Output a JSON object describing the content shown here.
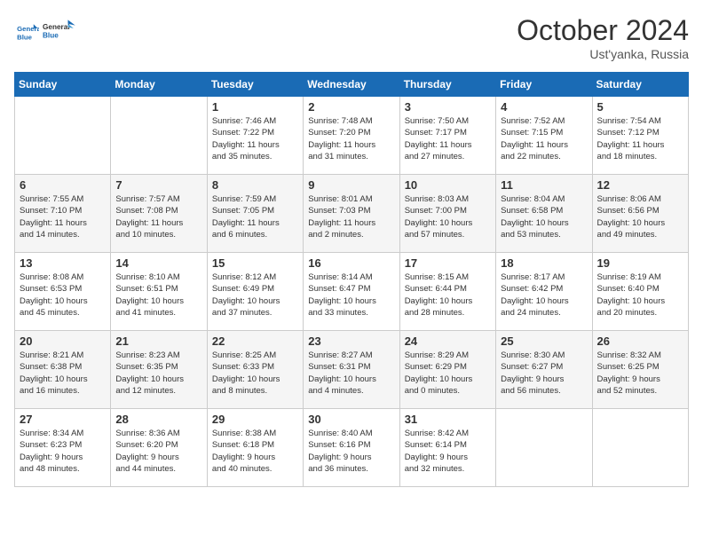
{
  "header": {
    "logo_line1": "General",
    "logo_line2": "Blue",
    "month": "October 2024",
    "location": "Ust'yanka, Russia"
  },
  "weekdays": [
    "Sunday",
    "Monday",
    "Tuesday",
    "Wednesday",
    "Thursday",
    "Friday",
    "Saturday"
  ],
  "weeks": [
    [
      {
        "day": "",
        "info": ""
      },
      {
        "day": "",
        "info": ""
      },
      {
        "day": "1",
        "info": "Sunrise: 7:46 AM\nSunset: 7:22 PM\nDaylight: 11 hours\nand 35 minutes."
      },
      {
        "day": "2",
        "info": "Sunrise: 7:48 AM\nSunset: 7:20 PM\nDaylight: 11 hours\nand 31 minutes."
      },
      {
        "day": "3",
        "info": "Sunrise: 7:50 AM\nSunset: 7:17 PM\nDaylight: 11 hours\nand 27 minutes."
      },
      {
        "day": "4",
        "info": "Sunrise: 7:52 AM\nSunset: 7:15 PM\nDaylight: 11 hours\nand 22 minutes."
      },
      {
        "day": "5",
        "info": "Sunrise: 7:54 AM\nSunset: 7:12 PM\nDaylight: 11 hours\nand 18 minutes."
      }
    ],
    [
      {
        "day": "6",
        "info": "Sunrise: 7:55 AM\nSunset: 7:10 PM\nDaylight: 11 hours\nand 14 minutes."
      },
      {
        "day": "7",
        "info": "Sunrise: 7:57 AM\nSunset: 7:08 PM\nDaylight: 11 hours\nand 10 minutes."
      },
      {
        "day": "8",
        "info": "Sunrise: 7:59 AM\nSunset: 7:05 PM\nDaylight: 11 hours\nand 6 minutes."
      },
      {
        "day": "9",
        "info": "Sunrise: 8:01 AM\nSunset: 7:03 PM\nDaylight: 11 hours\nand 2 minutes."
      },
      {
        "day": "10",
        "info": "Sunrise: 8:03 AM\nSunset: 7:00 PM\nDaylight: 10 hours\nand 57 minutes."
      },
      {
        "day": "11",
        "info": "Sunrise: 8:04 AM\nSunset: 6:58 PM\nDaylight: 10 hours\nand 53 minutes."
      },
      {
        "day": "12",
        "info": "Sunrise: 8:06 AM\nSunset: 6:56 PM\nDaylight: 10 hours\nand 49 minutes."
      }
    ],
    [
      {
        "day": "13",
        "info": "Sunrise: 8:08 AM\nSunset: 6:53 PM\nDaylight: 10 hours\nand 45 minutes."
      },
      {
        "day": "14",
        "info": "Sunrise: 8:10 AM\nSunset: 6:51 PM\nDaylight: 10 hours\nand 41 minutes."
      },
      {
        "day": "15",
        "info": "Sunrise: 8:12 AM\nSunset: 6:49 PM\nDaylight: 10 hours\nand 37 minutes."
      },
      {
        "day": "16",
        "info": "Sunrise: 8:14 AM\nSunset: 6:47 PM\nDaylight: 10 hours\nand 33 minutes."
      },
      {
        "day": "17",
        "info": "Sunrise: 8:15 AM\nSunset: 6:44 PM\nDaylight: 10 hours\nand 28 minutes."
      },
      {
        "day": "18",
        "info": "Sunrise: 8:17 AM\nSunset: 6:42 PM\nDaylight: 10 hours\nand 24 minutes."
      },
      {
        "day": "19",
        "info": "Sunrise: 8:19 AM\nSunset: 6:40 PM\nDaylight: 10 hours\nand 20 minutes."
      }
    ],
    [
      {
        "day": "20",
        "info": "Sunrise: 8:21 AM\nSunset: 6:38 PM\nDaylight: 10 hours\nand 16 minutes."
      },
      {
        "day": "21",
        "info": "Sunrise: 8:23 AM\nSunset: 6:35 PM\nDaylight: 10 hours\nand 12 minutes."
      },
      {
        "day": "22",
        "info": "Sunrise: 8:25 AM\nSunset: 6:33 PM\nDaylight: 10 hours\nand 8 minutes."
      },
      {
        "day": "23",
        "info": "Sunrise: 8:27 AM\nSunset: 6:31 PM\nDaylight: 10 hours\nand 4 minutes."
      },
      {
        "day": "24",
        "info": "Sunrise: 8:29 AM\nSunset: 6:29 PM\nDaylight: 10 hours\nand 0 minutes."
      },
      {
        "day": "25",
        "info": "Sunrise: 8:30 AM\nSunset: 6:27 PM\nDaylight: 9 hours\nand 56 minutes."
      },
      {
        "day": "26",
        "info": "Sunrise: 8:32 AM\nSunset: 6:25 PM\nDaylight: 9 hours\nand 52 minutes."
      }
    ],
    [
      {
        "day": "27",
        "info": "Sunrise: 8:34 AM\nSunset: 6:23 PM\nDaylight: 9 hours\nand 48 minutes."
      },
      {
        "day": "28",
        "info": "Sunrise: 8:36 AM\nSunset: 6:20 PM\nDaylight: 9 hours\nand 44 minutes."
      },
      {
        "day": "29",
        "info": "Sunrise: 8:38 AM\nSunset: 6:18 PM\nDaylight: 9 hours\nand 40 minutes."
      },
      {
        "day": "30",
        "info": "Sunrise: 8:40 AM\nSunset: 6:16 PM\nDaylight: 9 hours\nand 36 minutes."
      },
      {
        "day": "31",
        "info": "Sunrise: 8:42 AM\nSunset: 6:14 PM\nDaylight: 9 hours\nand 32 minutes."
      },
      {
        "day": "",
        "info": ""
      },
      {
        "day": "",
        "info": ""
      }
    ]
  ]
}
